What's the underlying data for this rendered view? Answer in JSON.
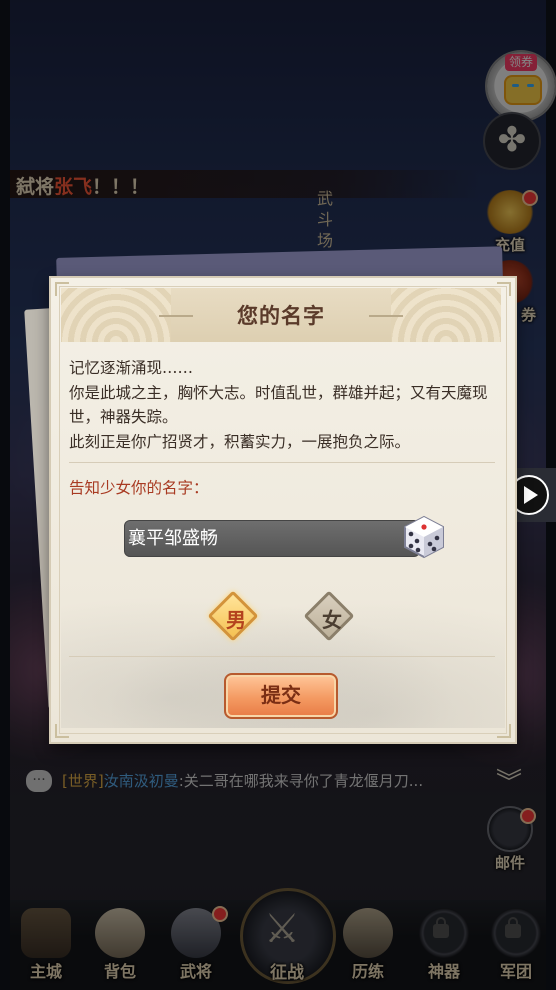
{
  "marquee": {
    "prefix": "弑将",
    "name": "张飞",
    "suffix": "！！！"
  },
  "scene": {
    "arena_sign": "武斗场"
  },
  "right_icons": {
    "coupon_tag": "领券",
    "recharge_label": "充值",
    "voucher_label": "券",
    "mail_label": "邮件"
  },
  "chat": {
    "channel": "[世界]",
    "sender": "汝南汲初曼",
    "text": ":关二哥在哪我来寻你了青龙偃月刀..."
  },
  "nav": {
    "items": [
      {
        "label": "主城",
        "icon": "city-icon"
      },
      {
        "label": "背包",
        "icon": "bag-icon"
      },
      {
        "label": "武将",
        "icon": "general-icon"
      },
      {
        "label": "征战",
        "icon": "crossed-swords-icon"
      },
      {
        "label": "历练",
        "icon": "scroll-icon"
      },
      {
        "label": "神器",
        "icon": "lock-icon"
      },
      {
        "label": "军团",
        "icon": "lock-icon"
      }
    ]
  },
  "modal": {
    "title": "您的名字",
    "story": [
      "记忆逐渐涌现……",
      "你是此城之主，胸怀大志。时值乱世，群雄并起；又有天魔现世，神器失踪。",
      "此刻正是你广招贤才，积蓄实力，一展抱负之际。"
    ],
    "prompt": "告知少女你的名字：",
    "name_value": "襄平邹盛畅",
    "gender_male": "男",
    "gender_female": "女",
    "selected_gender": "男",
    "submit_label": "提交"
  },
  "colors": {
    "accent": "#f49a62",
    "highlight_red": "#ff5a3a",
    "prompt_red": "#a83a22"
  }
}
